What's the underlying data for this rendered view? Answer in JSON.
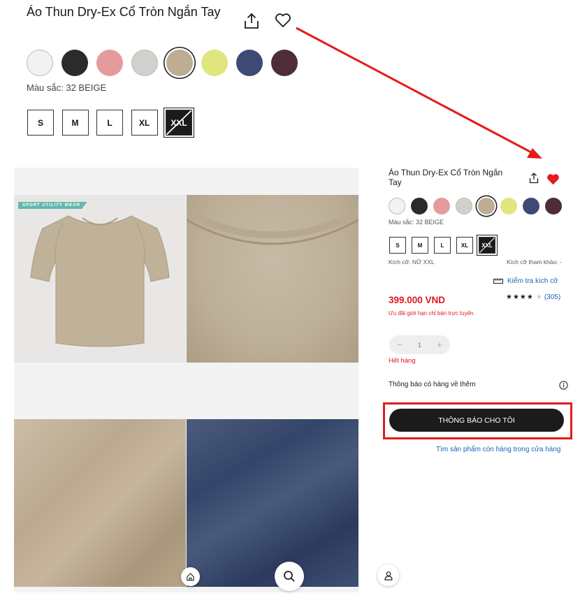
{
  "product": {
    "title": "Áo Thun Dry-Ex Cổ Tròn Ngắn Tay",
    "color_label": "Màu sắc: 32 BEIGE",
    "size_label": "Kích cỡ: NỮ XXL",
    "size_reference": "Kích cỡ tham khảo: -",
    "size_check": "Kiểm tra kích cỡ",
    "price": "399.000 VND",
    "promo_text": "Ưu đãi giới hạn chỉ bán trực tuyến",
    "rating_stars": "★★★★",
    "rating_empty_star": "★",
    "rating_count": "(305)",
    "quantity": "1",
    "out_of_stock": "Hết hàng",
    "notify_label": "Thông báo có hàng về thêm",
    "notify_button": "THÔNG BÁO CHO TÔI",
    "store_link": "Tìm sản phẩm còn hàng trong cửa hàng",
    "image_tag": "SPORT UTILITY WEAR"
  },
  "colors": [
    {
      "name": "white",
      "hex": "#f2f2f2"
    },
    {
      "name": "black",
      "hex": "#2b2b2b"
    },
    {
      "name": "pink",
      "hex": "#e59b9c"
    },
    {
      "name": "gray",
      "hex": "#d2d0cd"
    },
    {
      "name": "beige",
      "hex": "#bcad93",
      "selected": true
    },
    {
      "name": "lime",
      "hex": "#dfe67d"
    },
    {
      "name": "navy",
      "hex": "#3d4a74"
    },
    {
      "name": "wine",
      "hex": "#4e2c38"
    }
  ],
  "sizes": [
    {
      "label": "S"
    },
    {
      "label": "M"
    },
    {
      "label": "L"
    },
    {
      "label": "XL"
    },
    {
      "label": "XXL",
      "unavailable": true,
      "selected": true
    }
  ],
  "accent_colors": {
    "price_red": "#e0171b",
    "link_blue": "#1c63b7",
    "button_dark": "#1b1b1b",
    "highlight_red": "#e41b1b"
  }
}
